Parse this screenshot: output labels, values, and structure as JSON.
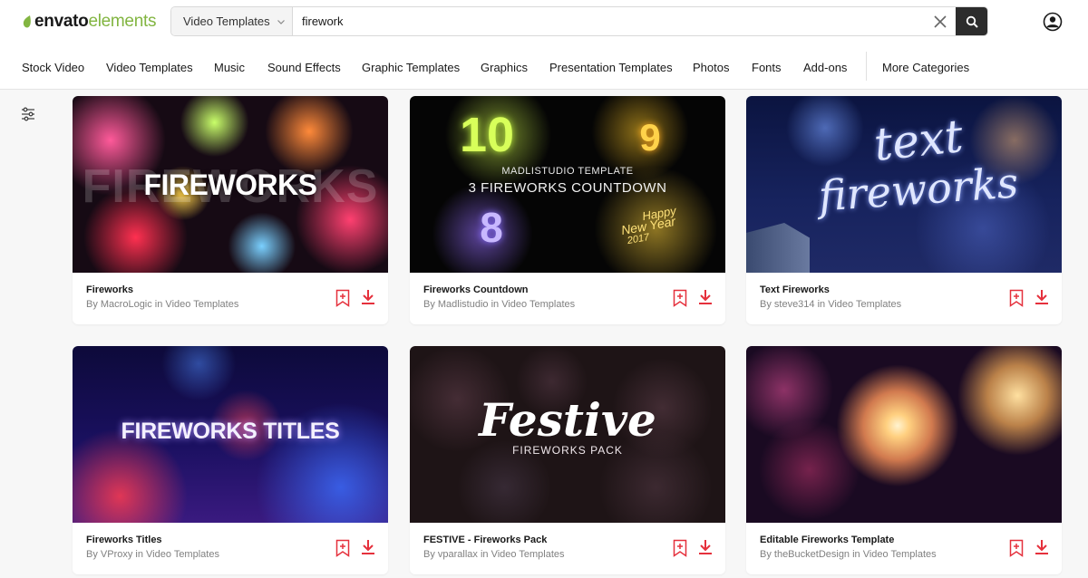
{
  "logo": {
    "part1": "envato",
    "part2": "elements"
  },
  "search": {
    "category": "Video Templates",
    "query": "firework"
  },
  "nav": [
    "Stock Video",
    "Video Templates",
    "Music",
    "Sound Effects",
    "Graphic Templates",
    "Graphics",
    "Presentation Templates",
    "Photos",
    "Fonts",
    "Add-ons",
    "More Categories"
  ],
  "cards": [
    {
      "title": "Fireworks",
      "byline": "By MacroLogic in Video Templates",
      "thumb_text": "FIREWORKS",
      "thumb_ghost": "FIREWORKS"
    },
    {
      "title": "Fireworks Countdown",
      "byline": "By Madlistudio in Video Templates",
      "thumb_line1": "MADLISTUDIO TEMPLATE",
      "thumb_line2": "3 FIREWORKS COUNTDOWN",
      "thumb_num1": "10",
      "thumb_num2": "9",
      "thumb_num3": "8",
      "thumb_happy": "Happy",
      "thumb_newyear": "New Year",
      "thumb_year": "2017"
    },
    {
      "title": "Text Fireworks",
      "byline": "By steve314 in Video Templates",
      "thumb_line1": "text",
      "thumb_line2": "fireworks"
    },
    {
      "title": "Fireworks Titles",
      "byline": "By VProxy in Video Templates",
      "thumb_text": "FIREWORKS TITLES"
    },
    {
      "title": "FESTIVE - Fireworks Pack",
      "byline": "By vparallax in Video Templates",
      "thumb_line1": "Festive",
      "thumb_line2": "FIREWORKS PACK"
    },
    {
      "title": "Editable Fireworks Template",
      "byline": "By theBucketDesign in Video Templates"
    }
  ],
  "colors": {
    "brand_green": "#82b541",
    "accent_red": "#e5303c",
    "search_button": "#2c2c2c"
  }
}
